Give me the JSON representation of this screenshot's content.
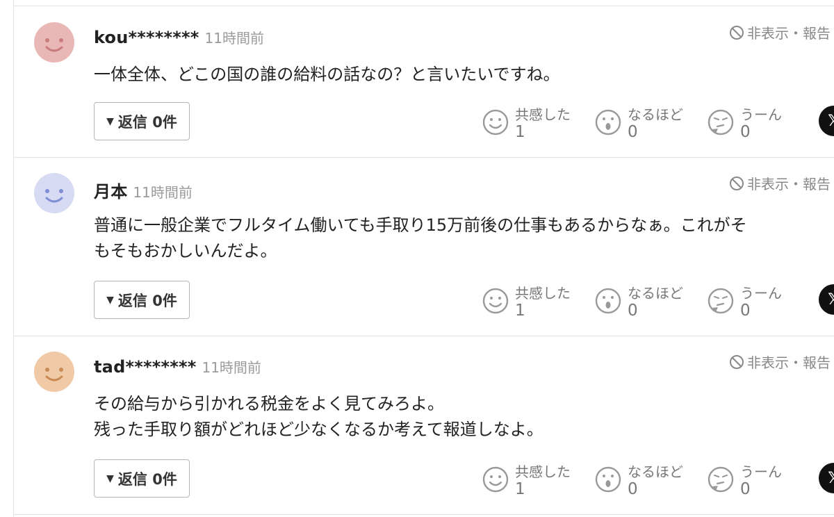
{
  "hide_report_label": "非表示・報告",
  "reply_label": "返信 0件",
  "x_icon_label": "𝕏",
  "reactions": {
    "empathy": "共感した",
    "insight": "なるほど",
    "hmm": "うーん"
  },
  "comments": [
    {
      "user": "kou********",
      "time": "11時間前",
      "avatar_color": "#e9b8b6",
      "avatar_face": "#c97b7b",
      "lines": [
        "一体全体、どこの国の誰の給料の話なの？と言いたいですね。"
      ],
      "counts": {
        "empathy": "1",
        "insight": "0",
        "hmm": "0"
      }
    },
    {
      "user": "月本",
      "time": "11時間前",
      "avatar_color": "#d6daf2",
      "avatar_face": "#7f8fd6",
      "lines": [
        "普通に一般企業でフルタイム働いても手取り15万前後の仕事もあるからなぁ。これがそ",
        "もそもおかしいんだよ。"
      ],
      "counts": {
        "empathy": "1",
        "insight": "0",
        "hmm": "0"
      }
    },
    {
      "user": "tad********",
      "time": "11時間前",
      "avatar_color": "#f0c9a6",
      "avatar_face": "#c98a55",
      "lines": [
        "その給与から引かれる税金をよく見てみろよ。",
        "残った手取り額がどれほど少なくなるか考えて報道しなよ。"
      ],
      "counts": {
        "empathy": "1",
        "insight": "0",
        "hmm": "0"
      }
    }
  ]
}
